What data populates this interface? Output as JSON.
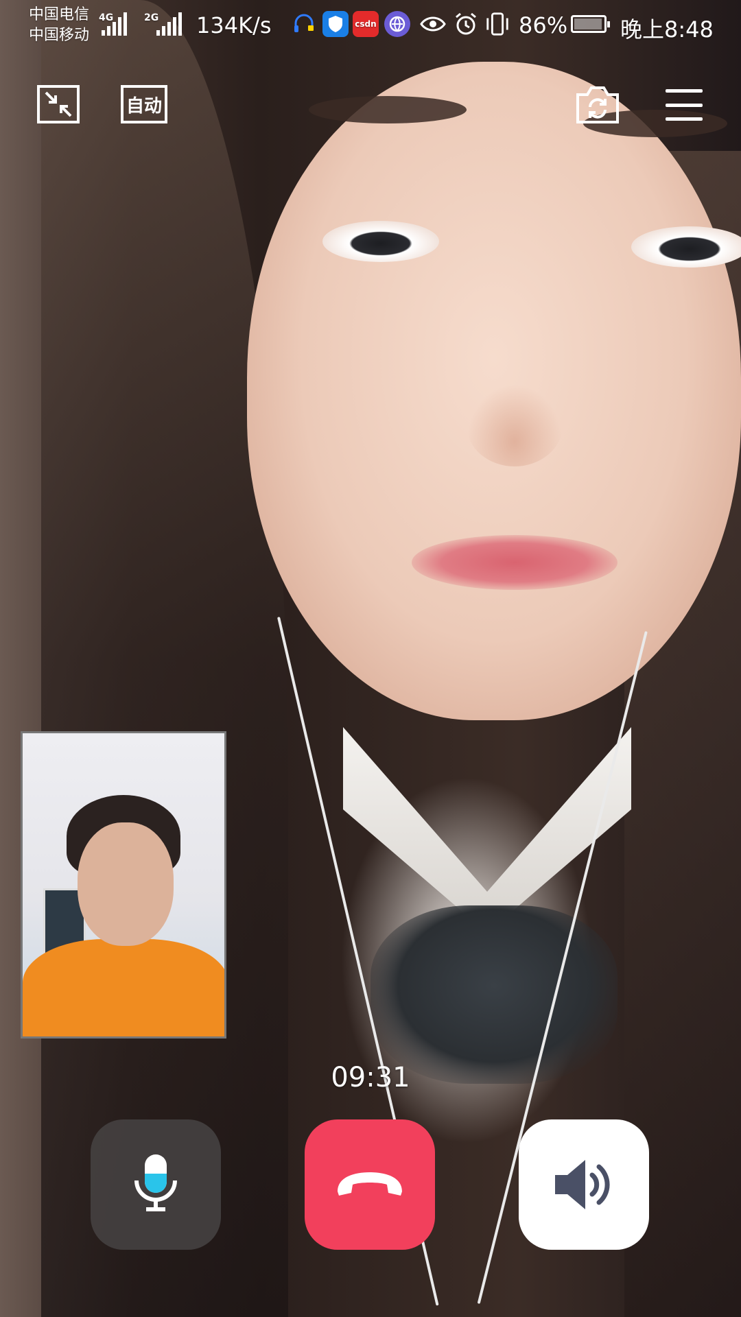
{
  "status_bar": {
    "carrier_1": "中国电信",
    "carrier_2": "中国移动",
    "network_1": "4G",
    "network_2": "2G",
    "net_speed": "134K/s",
    "app_icons": [
      "headset-icon",
      "shield-icon",
      "csdn-icon",
      "browser-icon"
    ],
    "csdn_label": "csdn",
    "battery_percent": "86%",
    "battery_level": 0.86,
    "time": "晚上8:48"
  },
  "top_controls": {
    "minimize_icon": "minimize-icon",
    "auto_label": "自动",
    "camera_flip_icon": "camera-switch-icon",
    "menu_icon": "menu-icon"
  },
  "call": {
    "duration": "09:31",
    "mic_icon": "microphone-icon",
    "hangup_icon": "hang-up-icon",
    "speaker_icon": "speaker-icon"
  },
  "colors": {
    "hangup": "#f2405c",
    "mic_accent": "#2ac4ea",
    "speaker_icon": "#4a5066"
  }
}
